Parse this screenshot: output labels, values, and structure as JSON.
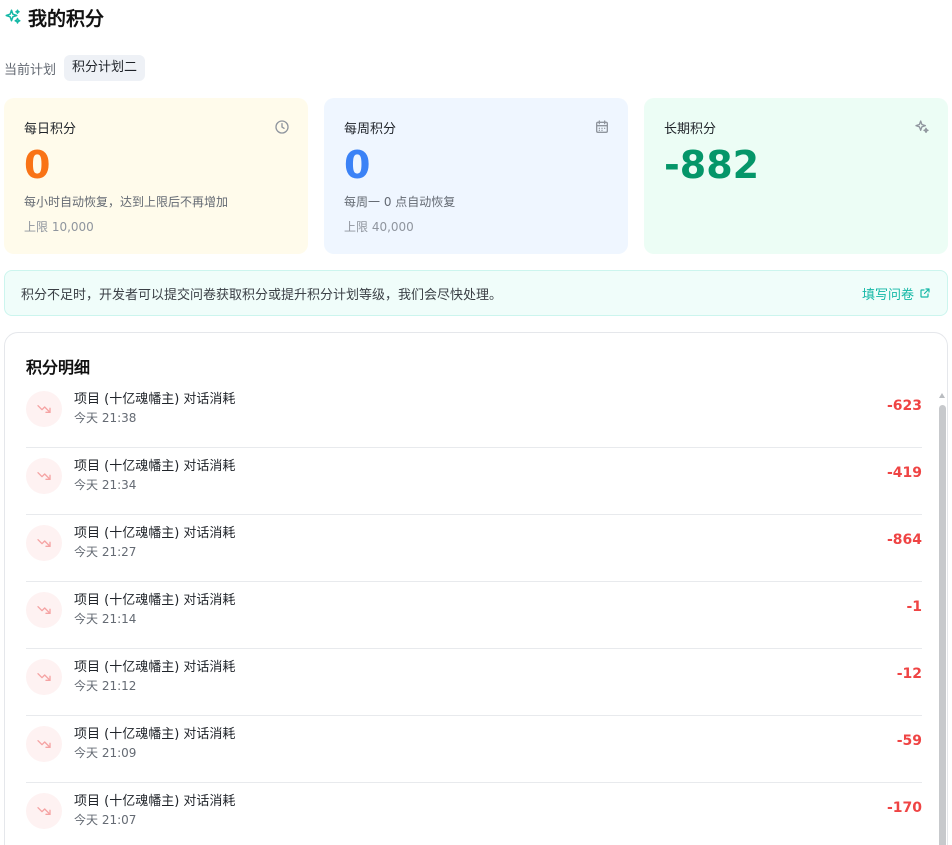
{
  "header": {
    "title": "我的积分",
    "icon": "sparkle-icon",
    "accent": "#14b8a6"
  },
  "plan": {
    "label": "当前计划",
    "value": "积分计划二"
  },
  "cards": {
    "daily": {
      "title": "每日积分",
      "value": "0",
      "desc": "每小时自动恢复，达到上限后不再增加",
      "limit": "上限 10,000",
      "icon": "clock-icon"
    },
    "weekly": {
      "title": "每周积分",
      "value": "0",
      "desc": "每周一 0 点自动恢复",
      "limit": "上限 40,000",
      "icon": "calendar-icon"
    },
    "long": {
      "title": "长期积分",
      "value": "-882",
      "icon": "sparkle-icon"
    }
  },
  "notice": {
    "message": "积分不足时，开发者可以提交问卷获取积分或提升积分计划等级，我们会尽快处理。",
    "link": "填写问卷"
  },
  "detail": {
    "title": "积分明细",
    "items": [
      {
        "name": "项目 (十亿魂幡主) 对话消耗",
        "time": "今天 21:38",
        "amount": "-623"
      },
      {
        "name": "项目 (十亿魂幡主) 对话消耗",
        "time": "今天 21:34",
        "amount": "-419"
      },
      {
        "name": "项目 (十亿魂幡主) 对话消耗",
        "time": "今天 21:27",
        "amount": "-864"
      },
      {
        "name": "项目 (十亿魂幡主) 对话消耗",
        "time": "今天 21:14",
        "amount": "-1"
      },
      {
        "name": "项目 (十亿魂幡主) 对话消耗",
        "time": "今天 21:12",
        "amount": "-12"
      },
      {
        "name": "项目 (十亿魂幡主) 对话消耗",
        "time": "今天 21:09",
        "amount": "-59"
      },
      {
        "name": "项目 (十亿魂幡主) 对话消耗",
        "time": "今天 21:07",
        "amount": "-170"
      }
    ]
  }
}
